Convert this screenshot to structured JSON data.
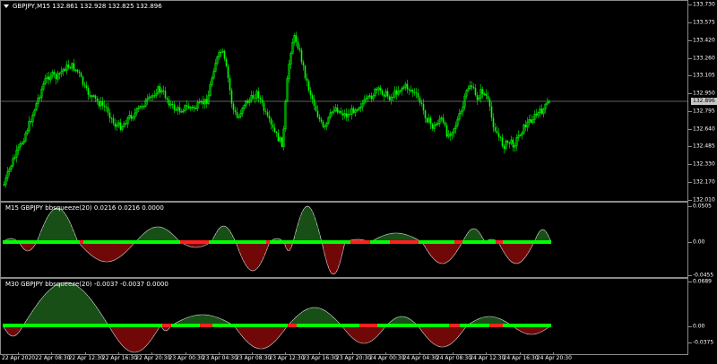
{
  "main_pane": {
    "title": "GBPJPY,M15  132.861 132.928 132.825 132.896",
    "price_labels": [
      "133.730",
      "133.575",
      "133.420",
      "133.260",
      "133.105",
      "132.950",
      "132.795",
      "132.640",
      "132.485",
      "132.330",
      "132.170",
      "132.010"
    ],
    "bid_label": "132.896",
    "bid_line_color": "#c0c0c0",
    "bull_color": "#00ff00",
    "bear_color": "#00ff00"
  },
  "indicator_m15": {
    "title": "M15 GBPJPY bbsqueeze(20) 0.0216 0.0216 0.0000",
    "axis_labels": [
      "0.0505",
      "0.00",
      "-0.0455"
    ]
  },
  "indicator_m30": {
    "title": "M30 GBPJPY bbsqueeze(20) -0.0037 -0.0037 0.0000",
    "axis_labels": [
      "0.0689",
      "0.00",
      "-0.0375"
    ]
  },
  "colors": {
    "positive": "#2e9e2e",
    "negative": "#e01010",
    "squeeze_on": "#00ff00",
    "squeeze_off": "#ff2020",
    "outline": "#d8d8d8"
  },
  "time_axis": {
    "labels": [
      "22 Apr 2020",
      "22 Apr 08:30",
      "22 Apr 12:30",
      "22 Apr 16:30",
      "22 Apr 20:30",
      "23 Apr 00:30",
      "23 Apr 04:30",
      "23 Apr 08:30",
      "23 Apr 12:30",
      "23 Apr 16:30",
      "23 Apr 20:30",
      "24 Apr 00:30",
      "24 Apr 04:30",
      "24 Apr 08:30",
      "24 Apr 12:30",
      "24 Apr 16:30",
      "24 Apr 20:30"
    ]
  }
}
